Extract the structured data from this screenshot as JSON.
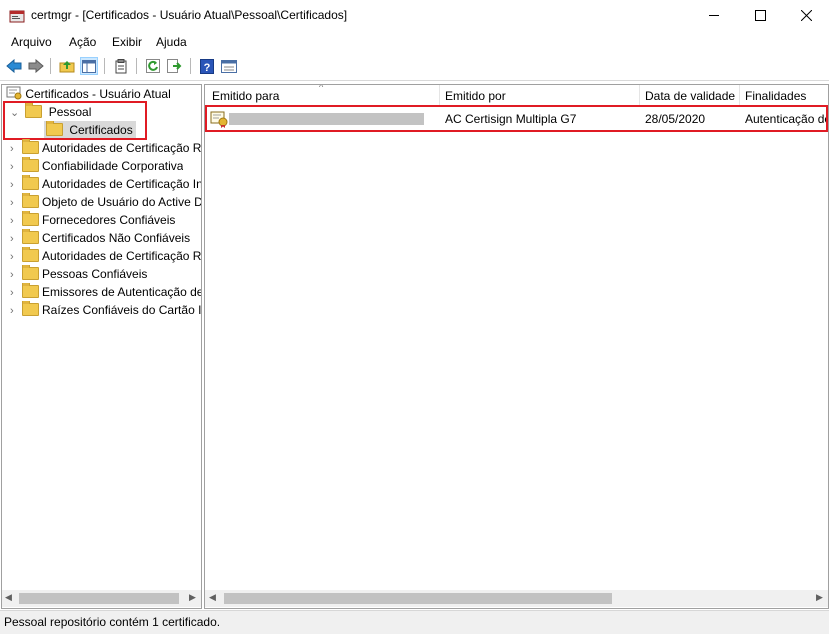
{
  "window": {
    "title": "certmgr - [Certificados - Usuário Atual\\Pessoal\\Certificados]",
    "minimize_glyph": "—",
    "maximize_glyph": "☐",
    "close_glyph": "✕"
  },
  "menu": [
    "Arquivo",
    "Ação",
    "Exibir",
    "Ajuda"
  ],
  "toolbar": {
    "icons": [
      "back-icon",
      "forward-icon",
      "up-folder-icon",
      "show-hide-tree-icon",
      "properties-icon",
      "refresh-icon",
      "export-list-icon",
      "help-icon",
      "console-icon"
    ]
  },
  "tree": {
    "root": "Certificados - Usuário Atual",
    "personal": "Pessoal",
    "personal_child": "Certificados",
    "stores": [
      "Autoridades de Certificação Raiz Confiáveis",
      "Confiabilidade Corporativa",
      "Autoridades de Certificação Intermediárias",
      "Objeto de Usuário do Active Directory",
      "Fornecedores Confiáveis",
      "Certificados Não Confiáveis",
      "Autoridades de Certificação Raiz de Terceiros",
      "Pessoas Confiáveis",
      "Emissores de Autenticação de Cliente",
      "Raízes Confiáveis do Cartão Inteligente"
    ]
  },
  "list": {
    "columns": [
      "Emitido para",
      "Emitido por",
      "Data de validade",
      "Finalidades"
    ],
    "rows": [
      {
        "issued_to": "",
        "issued_by": "AC Certisign Multipla G7",
        "expiry": "28/05/2020",
        "purposes": "Autenticação de Cliente"
      }
    ]
  },
  "status": "Pessoal repositório contém 1 certificado.",
  "colors": {
    "highlight_box": "#e01b24",
    "selection": "#cce8ff",
    "folder": "#f1c94f"
  }
}
